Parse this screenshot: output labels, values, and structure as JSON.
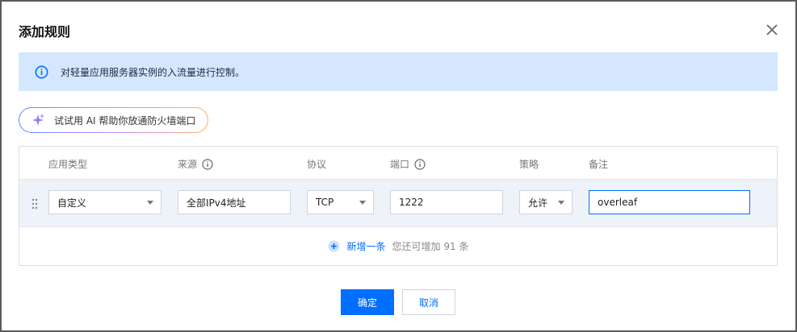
{
  "dialog": {
    "title": "添加规则"
  },
  "notice": {
    "text": "对轻量应用服务器实例的入流量进行控制。"
  },
  "ai_button": {
    "label": "试试用 AI 帮助你放通防火墙端口"
  },
  "table": {
    "headers": [
      "应用类型",
      "来源",
      "协议",
      "端口",
      "策略",
      "备注"
    ],
    "rows": [
      {
        "app_type": "自定义",
        "source": "全部IPv4地址",
        "protocol": "TCP",
        "port": "1222",
        "policy": "允许",
        "note": "overleaf"
      }
    ]
  },
  "add_row": {
    "link": "新增一条",
    "hint": "您还可增加 91 条"
  },
  "footer": {
    "ok": "确定",
    "cancel": "取消"
  },
  "colors": {
    "primary": "#006eff",
    "notice_bg": "#d5e7ff",
    "row_bg": "#eef2f9"
  },
  "icons": [
    "close-icon",
    "info-icon",
    "sparkle-icon",
    "question-icon",
    "drag-handle-icon",
    "plus-circle-icon",
    "chevron-down-icon"
  ]
}
